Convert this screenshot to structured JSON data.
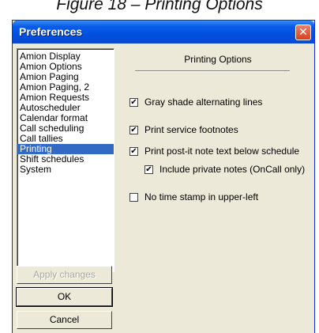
{
  "caption": "Figure 18 – Printing Options",
  "window": {
    "title": "Preferences",
    "close_glyph": "✕"
  },
  "sidebar": {
    "items": [
      {
        "label": "Amion Display",
        "selected": false
      },
      {
        "label": "Amion Options",
        "selected": false
      },
      {
        "label": "Amion Paging",
        "selected": false
      },
      {
        "label": "Amion Paging, 2",
        "selected": false
      },
      {
        "label": "Amion Requests",
        "selected": false
      },
      {
        "label": "Autoscheduler",
        "selected": false
      },
      {
        "label": "Calendar format",
        "selected": false
      },
      {
        "label": "Call scheduling",
        "selected": false
      },
      {
        "label": "Call tallies",
        "selected": false
      },
      {
        "label": "Printing",
        "selected": true
      },
      {
        "label": "Shift schedules",
        "selected": false
      },
      {
        "label": "System",
        "selected": false
      }
    ]
  },
  "buttons": {
    "apply_label": "Apply changes",
    "ok_label": "OK",
    "cancel_label": "Cancel"
  },
  "panel": {
    "heading": "Printing Options",
    "options": [
      {
        "label": "Gray shade alternating lines",
        "checked": true
      },
      {
        "label": "Print service footnotes",
        "checked": true
      },
      {
        "label": "Print post-it note text below schedule",
        "checked": true
      },
      {
        "label": "Include private notes (OnCall only)",
        "checked": true
      },
      {
        "label": "No time stamp in upper-left",
        "checked": false
      }
    ],
    "check_glyph": "✔"
  }
}
